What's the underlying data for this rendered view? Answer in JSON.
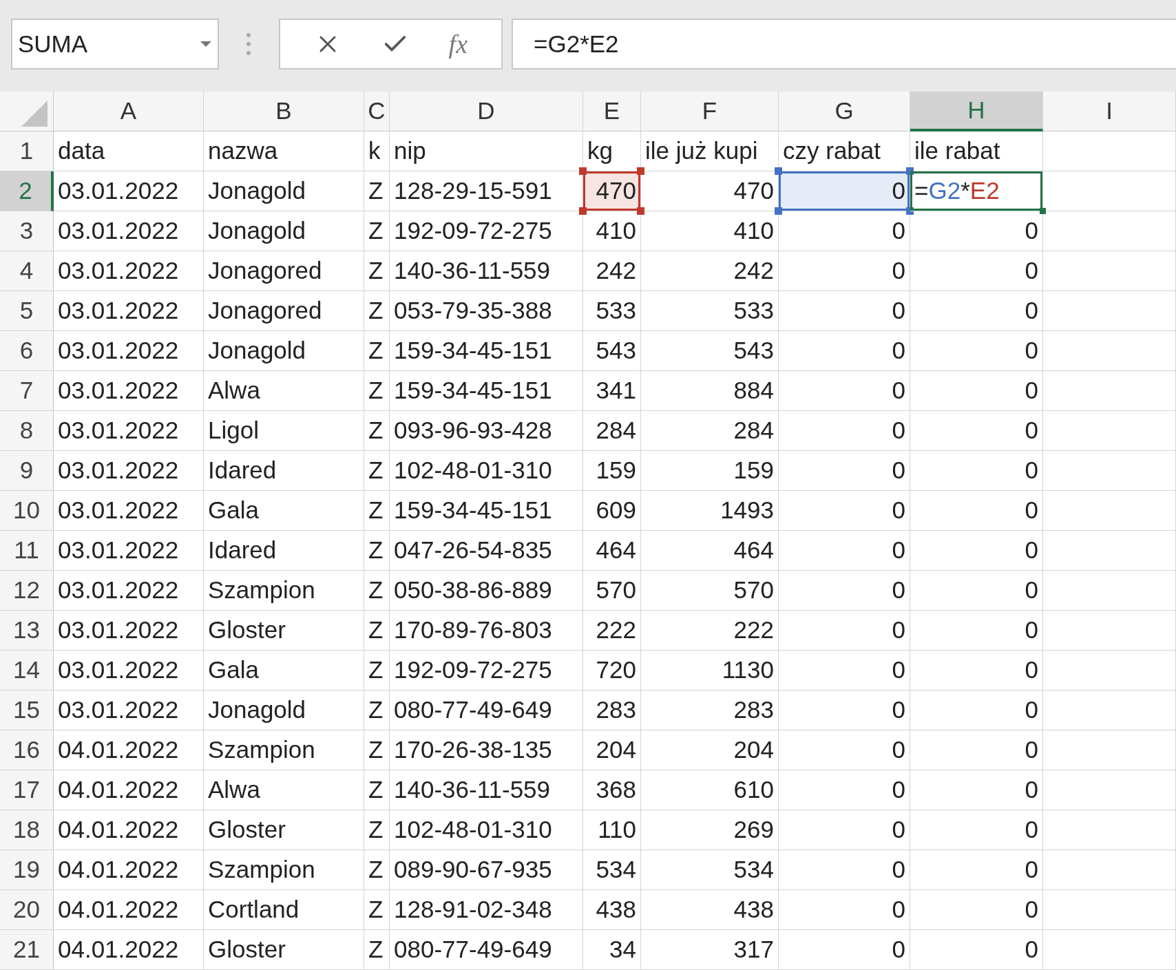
{
  "formula_bar": {
    "name_box": "SUMA",
    "fx_label": "fx",
    "formula": "=G2*E2"
  },
  "columns": [
    {
      "label": "A",
      "selected": false
    },
    {
      "label": "B",
      "selected": false
    },
    {
      "label": "C",
      "selected": false
    },
    {
      "label": "D",
      "selected": false
    },
    {
      "label": "E",
      "selected": false
    },
    {
      "label": "F",
      "selected": false
    },
    {
      "label": "G",
      "selected": false
    },
    {
      "label": "H",
      "selected": true
    },
    {
      "label": "I",
      "selected": false
    }
  ],
  "rows": [
    {
      "number": "1",
      "selected": false,
      "cells": [
        "data",
        "nazwa",
        "k",
        "nip",
        "kg",
        "ile już kupi",
        "czy rabat",
        "ile rabat",
        ""
      ],
      "kind": "header"
    },
    {
      "number": "2",
      "selected": true,
      "cells": [
        "03.01.2022",
        "Jonagold",
        "Z",
        "128-29-15-591",
        {
          "text": "470",
          "color": "#c0392b"
        },
        "470",
        {
          "text": "0",
          "color": "#4472c4"
        },
        {
          "editing": true,
          "segments": [
            {
              "text": "=",
              "color": "#222222"
            },
            {
              "text": "G2",
              "color": "#4472c4"
            },
            {
              "text": "*",
              "color": "#222222"
            },
            {
              "text": "E2",
              "color": "#c0392b"
            }
          ]
        },
        ""
      ],
      "kind": "data"
    },
    {
      "number": "3",
      "selected": false,
      "cells": [
        "03.01.2022",
        "Jonagold",
        "Z",
        "192-09-72-275",
        "410",
        "410",
        "0",
        "0",
        ""
      ],
      "kind": "data"
    },
    {
      "number": "4",
      "selected": false,
      "cells": [
        "03.01.2022",
        "Jonagored",
        "Z",
        "140-36-11-559",
        "242",
        "242",
        "0",
        "0",
        ""
      ],
      "kind": "data"
    },
    {
      "number": "5",
      "selected": false,
      "cells": [
        "03.01.2022",
        "Jonagored",
        "Z",
        "053-79-35-388",
        "533",
        "533",
        "0",
        "0",
        ""
      ],
      "kind": "data"
    },
    {
      "number": "6",
      "selected": false,
      "cells": [
        "03.01.2022",
        "Jonagold",
        "Z",
        "159-34-45-151",
        "543",
        "543",
        "0",
        "0",
        ""
      ],
      "kind": "data"
    },
    {
      "number": "7",
      "selected": false,
      "cells": [
        "03.01.2022",
        "Alwa",
        "Z",
        "159-34-45-151",
        "341",
        "884",
        "0",
        "0",
        ""
      ],
      "kind": "data"
    },
    {
      "number": "8",
      "selected": false,
      "cells": [
        "03.01.2022",
        "Ligol",
        "Z",
        "093-96-93-428",
        "284",
        "284",
        "0",
        "0",
        ""
      ],
      "kind": "data"
    },
    {
      "number": "9",
      "selected": false,
      "cells": [
        "03.01.2022",
        "Idared",
        "Z",
        "102-48-01-310",
        "159",
        "159",
        "0",
        "0",
        ""
      ],
      "kind": "data"
    },
    {
      "number": "10",
      "selected": false,
      "cells": [
        "03.01.2022",
        "Gala",
        "Z",
        "159-34-45-151",
        "609",
        "1493",
        "0",
        "0",
        ""
      ],
      "kind": "data"
    },
    {
      "number": "11",
      "selected": false,
      "cells": [
        "03.01.2022",
        "Idared",
        "Z",
        "047-26-54-835",
        "464",
        "464",
        "0",
        "0",
        ""
      ],
      "kind": "data"
    },
    {
      "number": "12",
      "selected": false,
      "cells": [
        "03.01.2022",
        "Szampion",
        "Z",
        "050-38-86-889",
        "570",
        "570",
        "0",
        "0",
        ""
      ],
      "kind": "data"
    },
    {
      "number": "13",
      "selected": false,
      "cells": [
        "03.01.2022",
        "Gloster",
        "Z",
        "170-89-76-803",
        "222",
        "222",
        "0",
        "0",
        ""
      ],
      "kind": "data"
    },
    {
      "number": "14",
      "selected": false,
      "cells": [
        "03.01.2022",
        "Gala",
        "Z",
        "192-09-72-275",
        "720",
        "1130",
        "0",
        "0",
        ""
      ],
      "kind": "data"
    },
    {
      "number": "15",
      "selected": false,
      "cells": [
        "03.01.2022",
        "Jonagold",
        "Z",
        "080-77-49-649",
        "283",
        "283",
        "0",
        "0",
        ""
      ],
      "kind": "data"
    },
    {
      "number": "16",
      "selected": false,
      "cells": [
        "04.01.2022",
        "Szampion",
        "Z",
        "170-26-38-135",
        "204",
        "204",
        "0",
        "0",
        ""
      ],
      "kind": "data"
    },
    {
      "number": "17",
      "selected": false,
      "cells": [
        "04.01.2022",
        "Alwa",
        "Z",
        "140-36-11-559",
        "368",
        "610",
        "0",
        "0",
        ""
      ],
      "kind": "data"
    },
    {
      "number": "18",
      "selected": false,
      "cells": [
        "04.01.2022",
        "Gloster",
        "Z",
        "102-48-01-310",
        "110",
        "269",
        "0",
        "0",
        ""
      ],
      "kind": "data"
    },
    {
      "number": "19",
      "selected": false,
      "cells": [
        "04.01.2022",
        "Szampion",
        "Z",
        "089-90-67-935",
        "534",
        "534",
        "0",
        "0",
        ""
      ],
      "kind": "data"
    },
    {
      "number": "20",
      "selected": false,
      "cells": [
        "04.01.2022",
        "Cortland",
        "Z",
        "128-91-02-348",
        "438",
        "438",
        "0",
        "0",
        ""
      ],
      "kind": "data"
    },
    {
      "number": "21",
      "selected": false,
      "cells": [
        "04.01.2022",
        "Gloster",
        "Z",
        "080-77-49-649",
        "34",
        "317",
        "0",
        "0",
        ""
      ],
      "kind": "data"
    }
  ]
}
